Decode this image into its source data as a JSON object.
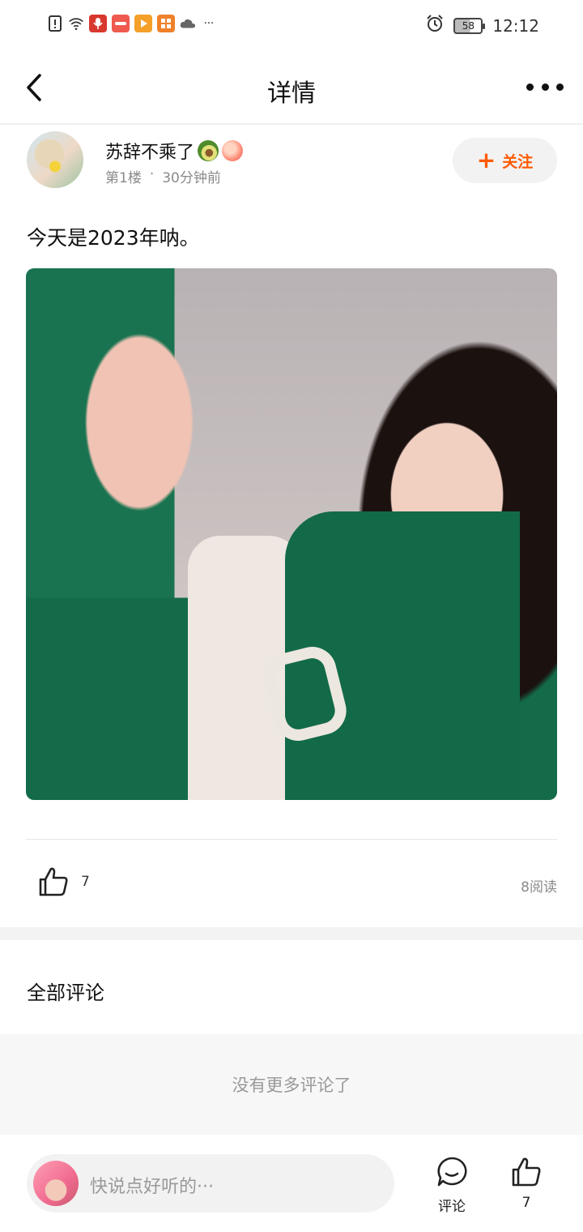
{
  "status_bar": {
    "time": "12:12",
    "battery": "58",
    "more": "···"
  },
  "header": {
    "title": "详情"
  },
  "post": {
    "author": {
      "name": "苏辞不乘了"
    },
    "floor": "第1楼",
    "dot": "·",
    "time_ago": "30分钟前",
    "follow_label": "关注",
    "text": "今天是2023年呐。",
    "likes": "7",
    "reads": "8阅读"
  },
  "comments": {
    "title": "全部评论",
    "empty_text": "没有更多评论了"
  },
  "bottom_bar": {
    "input_placeholder": "快说点好听的···",
    "comment_label": "评论",
    "like_count": "7"
  },
  "colors": {
    "accent": "#ff5a00",
    "muted_text": "#8a8a8a",
    "band": "#f3f3f3"
  }
}
